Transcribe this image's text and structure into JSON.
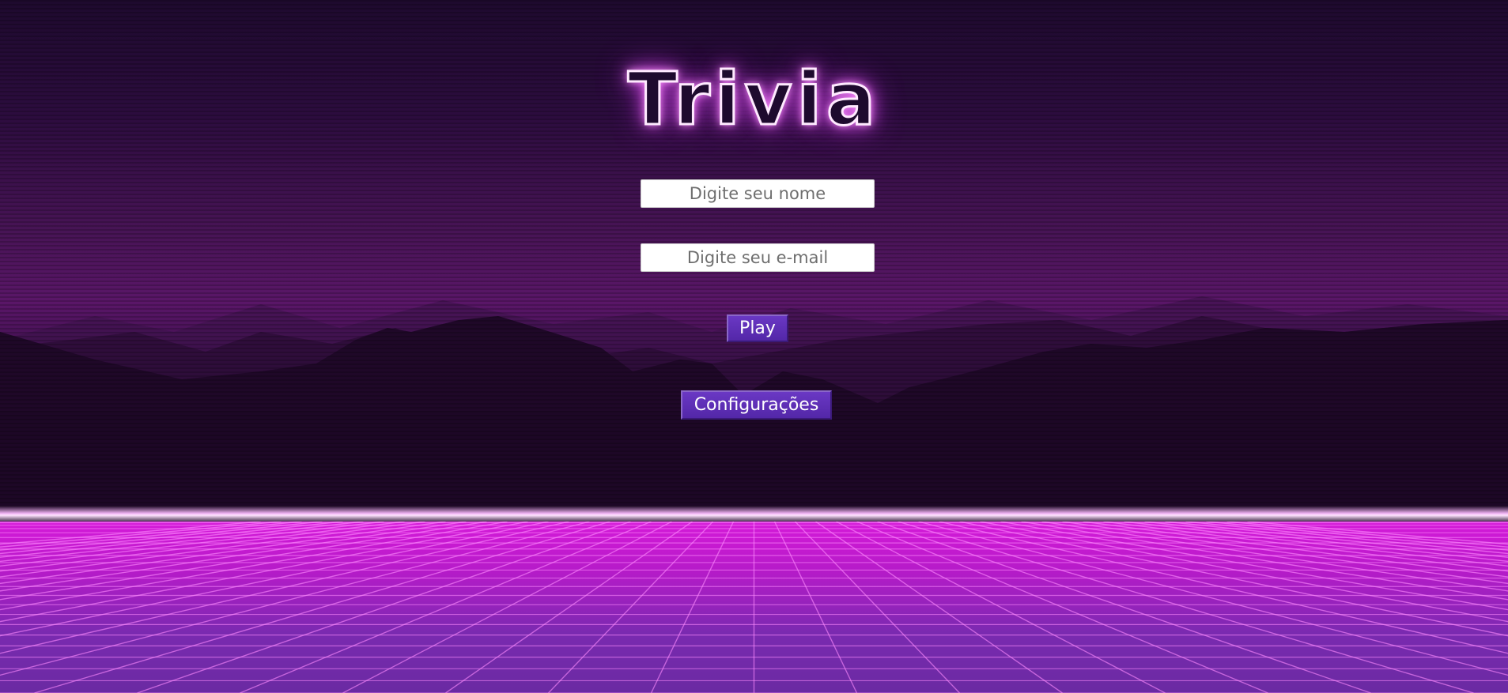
{
  "app": {
    "title": "Trivia"
  },
  "form": {
    "name_placeholder": "Digite seu nome",
    "email_placeholder": "Digite seu e-mail",
    "name_value": "",
    "email_value": ""
  },
  "buttons": {
    "play_label": "Play",
    "settings_label": "Configurações"
  },
  "colors": {
    "button_bg": "#5a2db4",
    "title_glow": "#e35bf0",
    "floor_grid": "#ff8cff"
  },
  "icons": []
}
